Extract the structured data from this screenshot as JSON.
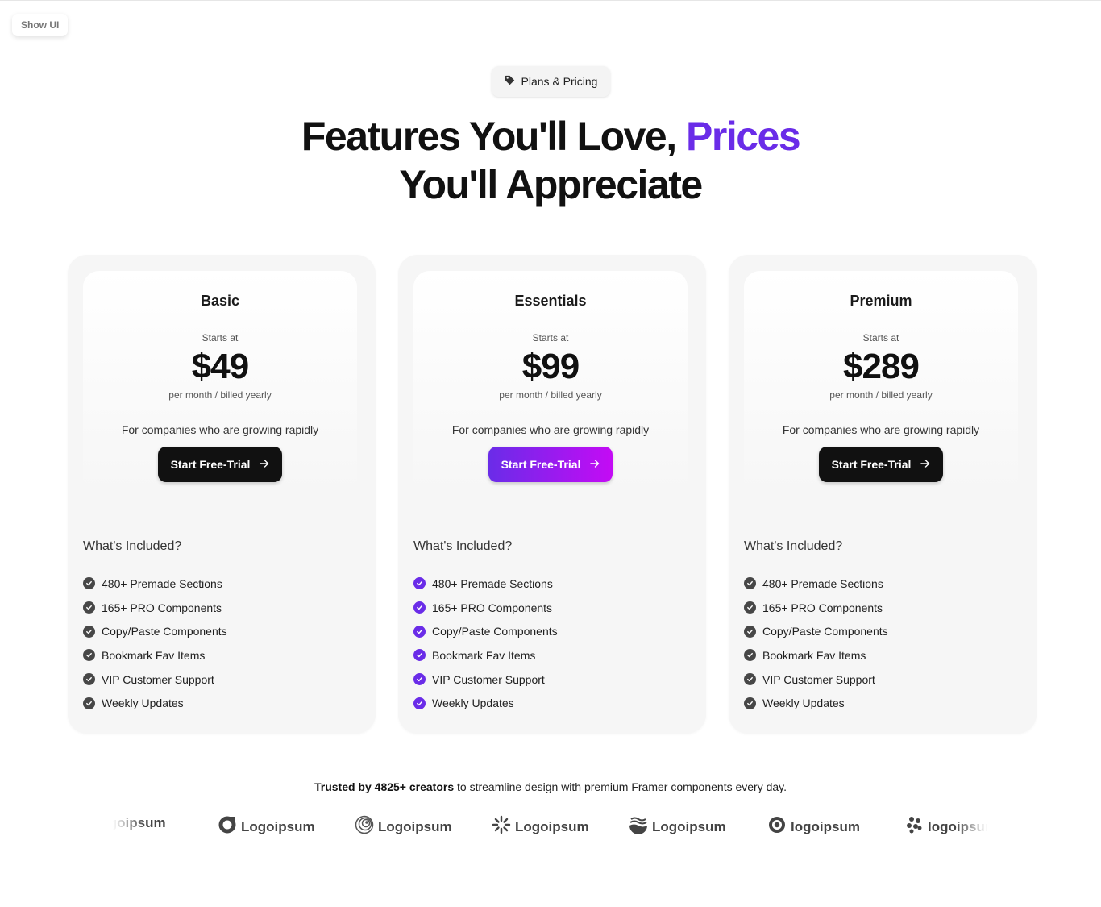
{
  "ui": {
    "show_ui_label": "Show UI"
  },
  "hero": {
    "tag_icon": "tag-icon",
    "tag_label": "Plans & Pricing",
    "headline_part1": "Features You'll Love, ",
    "headline_accent": "Prices",
    "headline_part2": "You'll Appreciate"
  },
  "colors": {
    "accent": "#6a2ce8",
    "gradient_end": "#c40bf5",
    "dark": "#111111"
  },
  "plans": [
    {
      "name": "Basic",
      "starts_label": "Starts at",
      "price": "$49",
      "billing": "per month / billed yearly",
      "description": "For companies who are growing rapidly",
      "cta": "Start Free-Trial",
      "highlighted": false,
      "included_title": "What's Included?",
      "features": [
        "480+ Premade Sections",
        "165+ PRO Components",
        "Copy/Paste Components",
        "Bookmark Fav Items",
        "VIP Customer Support",
        "Weekly Updates"
      ]
    },
    {
      "name": "Essentials",
      "starts_label": "Starts at",
      "price": "$99",
      "billing": "per month / billed yearly",
      "description": "For companies who are growing rapidly",
      "cta": "Start Free-Trial",
      "highlighted": true,
      "included_title": "What's Included?",
      "features": [
        "480+ Premade Sections",
        "165+ PRO Components",
        "Copy/Paste Components",
        "Bookmark Fav Items",
        "VIP Customer Support",
        "Weekly Updates"
      ]
    },
    {
      "name": "Premium",
      "starts_label": "Starts at",
      "price": "$289",
      "billing": "per month / billed yearly",
      "description": "For companies who are growing rapidly",
      "cta": "Start Free-Trial",
      "highlighted": false,
      "included_title": "What's Included?",
      "features": [
        "480+ Premade Sections",
        "165+ PRO Components",
        "Copy/Paste Components",
        "Bookmark Fav Items",
        "VIP Customer Support",
        "Weekly Updates"
      ]
    }
  ],
  "trusted": {
    "bold": "Trusted by 4825+ creators",
    "rest": " to streamline design with premium Framer components every day."
  },
  "logos": [
    {
      "icon": "none",
      "text": "Logoipsum"
    },
    {
      "icon": "ring-logo-icon",
      "text": "Logoipsum"
    },
    {
      "icon": "spiral-logo-icon",
      "text": "Logoipsum"
    },
    {
      "icon": "sunburst-logo-icon",
      "text": "Logoipsum"
    },
    {
      "icon": "waves-logo-icon",
      "text": "Logoipsum"
    },
    {
      "icon": "eye-logo-icon",
      "text": "logoipsum"
    },
    {
      "icon": "cluster-logo-icon",
      "text": "logoipsum"
    }
  ]
}
